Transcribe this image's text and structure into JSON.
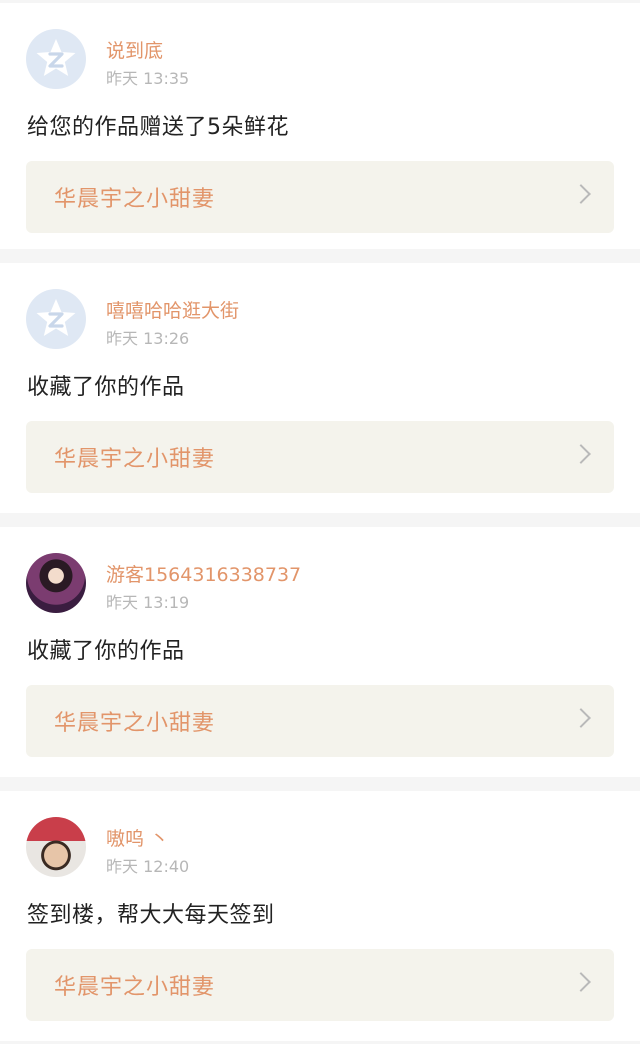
{
  "notifications": [
    {
      "name": "说到底",
      "time": "昨天 13:35",
      "avatar": "default-avatar-icon",
      "message": "给您的作品赠送了5朵鲜花",
      "work_title": "华晨宇之小甜妻"
    },
    {
      "name": "嘻嘻哈哈逛大街",
      "time": "昨天 13:26",
      "avatar": "default-avatar-icon",
      "message": "收藏了你的作品",
      "work_title": "华晨宇之小甜妻"
    },
    {
      "name": "游客1564316338737",
      "time": "昨天 13:19",
      "avatar": "user-photo",
      "message": "收藏了你的作品",
      "work_title": "华晨宇之小甜妻"
    },
    {
      "name": "嗷呜 丶",
      "time": "昨天 12:40",
      "avatar": "user-photo",
      "message": "签到楼，帮大大每天签到",
      "work_title": "华晨宇之小甜妻"
    }
  ],
  "colors": {
    "accent": "#e2956a",
    "link_bg": "#f4f3ec",
    "time": "#b7b7b7",
    "divider": "#f5f5f5"
  }
}
